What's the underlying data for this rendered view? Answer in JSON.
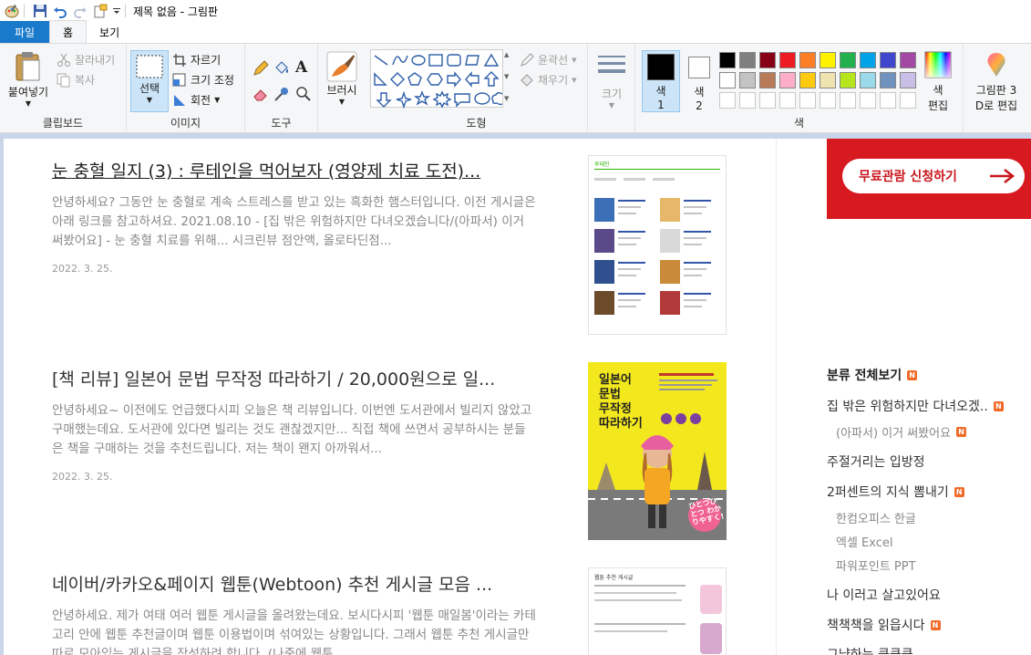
{
  "window": {
    "title": "제목 없음 - 그림판"
  },
  "tabs": [
    {
      "label": "파일"
    },
    {
      "label": "홈"
    },
    {
      "label": "보기"
    }
  ],
  "ribbon": {
    "clipboard": {
      "paste": "붙여넣기",
      "cut": "잘라내기",
      "copy": "복사",
      "label": "클립보드"
    },
    "image": {
      "select": "선택",
      "crop": "자르기",
      "resize": "크기 조정",
      "rotate": "회전",
      "label": "이미지"
    },
    "tools": {
      "label": "도구"
    },
    "brushes": {
      "label": "브러시"
    },
    "shapes": {
      "outline": "윤곽선",
      "fill": "채우기",
      "label": "도형"
    },
    "size": {
      "label": "크기"
    },
    "color1": {
      "line1": "색",
      "line2": "1"
    },
    "color2": {
      "line1": "색",
      "line2": "2"
    },
    "colors": {
      "label": "색",
      "edit_line1": "색",
      "edit_line2": "편집"
    },
    "paint3d": {
      "line1": "그림판 3",
      "line2": "D로 편집"
    },
    "palette_colors": [
      "#000000",
      "#7f7f7f",
      "#880015",
      "#ed1c24",
      "#ff7f27",
      "#fff200",
      "#22b14c",
      "#00a2e8",
      "#3f48cc",
      "#a349a4",
      "#ffffff",
      "#c3c3c3",
      "#b97a57",
      "#ffaec9",
      "#ffc90e",
      "#efe4b0",
      "#b5e61d",
      "#99d9ea",
      "#7092be",
      "#c8bfe7"
    ]
  },
  "posts": [
    {
      "title": "눈 충혈 일지 (3) : 루테인을 먹어보자 (영양제 치료 도전)...",
      "excerpt": "안녕하세요? 그동안 눈 충혈로 계속 스트레스를 받고 있는 흑화한 햄스터입니다. 이전 게시글은 아래 링크를 참고하셔요. 2021.08.10 - [집 밖은 위험하지만 다녀오겠습니다/(아파서) 이거 써봤어요] - 눈 충혈 치료를 위해... 시크린뷰 점안액, 올로타딘점...",
      "date": "2022. 3. 25."
    },
    {
      "title": "[책 리뷰] 일본어 문법 무작정 따라하기 / 20,000원으로 일...",
      "excerpt": "안녕하세요~ 이전에도 언급했다시피 오늘은 책 리뷰입니다. 이번엔 도서관에서 빌리지 않았고 구매했는데요. 도서관에 있다면 빌리는 것도 괜찮겠지만... 직접 책에 쓰면서 공부하시는 분들은 책을 구매하는 것을 추천드립니다. 저는 책이 왠지 아까워서...",
      "date": "2022. 3. 25."
    },
    {
      "title": "네이버/카카오&페이지 웹툰(Webtoon) 추천 게시글 모음 ...",
      "excerpt": "안녕하세요. 제가 여태 여러 웹툰 게시글을 올려왔는데요. 보시다시피 '웹툰 매일봄'이라는 카테고리 안에 웹툰 추천글이며 웹툰 이용법이며 섞여있는 상황입니다. 그래서 웹툰 추천 게시글만 따로 모아있는 게시글을 작성하려 합니다. (나중에 웹툰...",
      "date": ""
    }
  ],
  "book_cover": {
    "title_lines": [
      "일본어",
      "문법",
      "무작정",
      "따라하기"
    ],
    "badge": "ひとつひとつ わかりやすく!"
  },
  "banner": {
    "label": "무료관람 신청하기"
  },
  "thumb_texts": {
    "t1": "루테인",
    "t3": "웹툰 추천 게시글"
  },
  "sidebar": {
    "categories": [
      {
        "label": "분류 전체보기",
        "badge": "N"
      },
      {
        "label": "집 밖은 위험하지만 다녀오겠..",
        "badge": "N"
      },
      {
        "label": "(아파서) 이거 써봤어요",
        "badge": "N"
      },
      {
        "label": "주절거리는 입방정",
        "badge": ""
      },
      {
        "label": "2퍼센트의 지식 뽐내기",
        "badge": "N"
      },
      {
        "label": "한컴오피스 한글",
        "badge": ""
      },
      {
        "label": "엑셀 Excel",
        "badge": ""
      },
      {
        "label": "파워포인트 PPT",
        "badge": ""
      },
      {
        "label": "나 이러고 살고있어요",
        "badge": ""
      },
      {
        "label": "책책책을 읽읍시다",
        "badge": "N"
      },
      {
        "label": "그냥하는 킁킁킁",
        "badge": ""
      }
    ]
  }
}
